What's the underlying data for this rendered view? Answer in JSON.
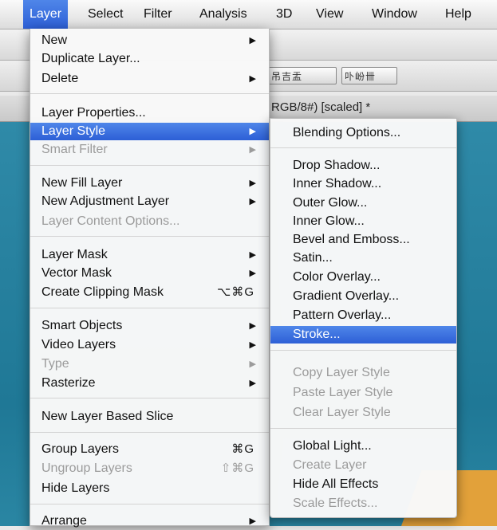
{
  "menubar": {
    "items": [
      "Layer",
      "Select",
      "Filter",
      "Analysis",
      "3D",
      "View",
      "Window",
      "Help"
    ]
  },
  "document": {
    "tab_title": "RGB/8#) [scaled] *"
  },
  "toolbar_glyphs": [
    "吊吉盂",
    "卟岎卌"
  ],
  "layer_menu": {
    "items": [
      {
        "label": "New",
        "submenu": true
      },
      {
        "label": "Duplicate Layer..."
      },
      {
        "label": "Delete",
        "submenu": true
      },
      {
        "label": "Layer Properties..."
      },
      {
        "label": "Layer Style",
        "submenu": true,
        "highlighted": true
      },
      {
        "label": "Smart Filter",
        "submenu": true,
        "disabled": true
      },
      {
        "label": "New Fill Layer",
        "submenu": true
      },
      {
        "label": "New Adjustment Layer",
        "submenu": true
      },
      {
        "label": "Layer Content Options...",
        "disabled": true
      },
      {
        "label": "Layer Mask",
        "submenu": true
      },
      {
        "label": "Vector Mask",
        "submenu": true
      },
      {
        "label": "Create Clipping Mask",
        "shortcut": "⌥⌘G"
      },
      {
        "label": "Smart Objects",
        "submenu": true
      },
      {
        "label": "Video Layers",
        "submenu": true
      },
      {
        "label": "Type",
        "submenu": true,
        "disabled": true
      },
      {
        "label": "Rasterize",
        "submenu": true
      },
      {
        "label": "New Layer Based Slice"
      },
      {
        "label": "Group Layers",
        "shortcut": "⌘G"
      },
      {
        "label": "Ungroup Layers",
        "shortcut": "⇧⌘G",
        "disabled": true
      },
      {
        "label": "Hide Layers"
      },
      {
        "label": "Arrange",
        "submenu": true
      }
    ]
  },
  "layer_style_menu": {
    "items": [
      {
        "label": "Blending Options..."
      },
      {
        "label": "Drop Shadow..."
      },
      {
        "label": "Inner Shadow..."
      },
      {
        "label": "Outer Glow..."
      },
      {
        "label": "Inner Glow..."
      },
      {
        "label": "Bevel and Emboss..."
      },
      {
        "label": "Satin..."
      },
      {
        "label": "Color Overlay..."
      },
      {
        "label": "Gradient Overlay..."
      },
      {
        "label": "Pattern Overlay..."
      },
      {
        "label": "Stroke...",
        "highlighted": true
      },
      {
        "label": "Copy Layer Style",
        "disabled": true
      },
      {
        "label": "Paste Layer Style",
        "disabled": true
      },
      {
        "label": "Clear Layer Style",
        "disabled": true
      },
      {
        "label": "Global Light..."
      },
      {
        "label": "Create Layer",
        "disabled": true
      },
      {
        "label": "Hide All Effects"
      },
      {
        "label": "Scale Effects...",
        "disabled": true
      }
    ]
  },
  "glyphs": {
    "submenu_arrow": "▶"
  },
  "colors": {
    "highlight": "#3b6fe0",
    "disabled_text": "#9b9b9b",
    "canvas": "#2583a1"
  }
}
